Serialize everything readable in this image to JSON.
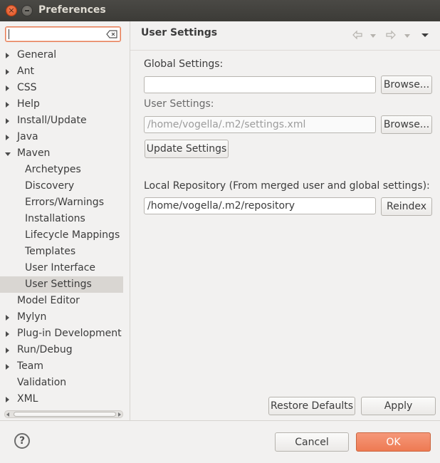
{
  "window": {
    "title": "Preferences"
  },
  "filter": {
    "value": ""
  },
  "tree": {
    "items": [
      {
        "label": "General",
        "expander": "collapsed"
      },
      {
        "label": "Ant",
        "expander": "collapsed"
      },
      {
        "label": "CSS",
        "expander": "collapsed"
      },
      {
        "label": "Help",
        "expander": "collapsed"
      },
      {
        "label": "Install/Update",
        "expander": "collapsed"
      },
      {
        "label": "Java",
        "expander": "collapsed"
      },
      {
        "label": "Maven",
        "expander": "expanded"
      },
      {
        "label": "Archetypes",
        "expander": "none"
      },
      {
        "label": "Discovery",
        "expander": "none"
      },
      {
        "label": "Errors/Warnings",
        "expander": "none"
      },
      {
        "label": "Installations",
        "expander": "none"
      },
      {
        "label": "Lifecycle Mappings",
        "expander": "none"
      },
      {
        "label": "Templates",
        "expander": "none"
      },
      {
        "label": "User Interface",
        "expander": "none"
      },
      {
        "label": "User Settings",
        "expander": "none",
        "selected": true
      },
      {
        "label": "Model Editor",
        "expander": "none"
      },
      {
        "label": "Mylyn",
        "expander": "collapsed"
      },
      {
        "label": "Plug-in Development",
        "expander": "collapsed"
      },
      {
        "label": "Run/Debug",
        "expander": "collapsed"
      },
      {
        "label": "Team",
        "expander": "collapsed"
      },
      {
        "label": "Validation",
        "expander": "none"
      },
      {
        "label": "XML",
        "expander": "collapsed"
      }
    ]
  },
  "page": {
    "title": "User Settings",
    "global_settings_label": "Global Settings:",
    "global_settings_value": "",
    "user_settings_label": "User Settings:",
    "user_settings_value": "/home/vogella/.m2/settings.xml",
    "browse_label": "Browse...",
    "update_settings_label": "Update Settings",
    "local_repo_label": "Local Repository (From merged user and global settings):",
    "local_repo_value": "/home/vogella/.m2/repository",
    "reindex_label": "Reindex",
    "restore_defaults_label": "Restore Defaults",
    "apply_label": "Apply"
  },
  "footer": {
    "help_glyph": "?",
    "cancel_label": "Cancel",
    "ok_label": "OK"
  },
  "colors": {
    "accent": "#ee7a52",
    "selection": "#d9d6d2"
  }
}
